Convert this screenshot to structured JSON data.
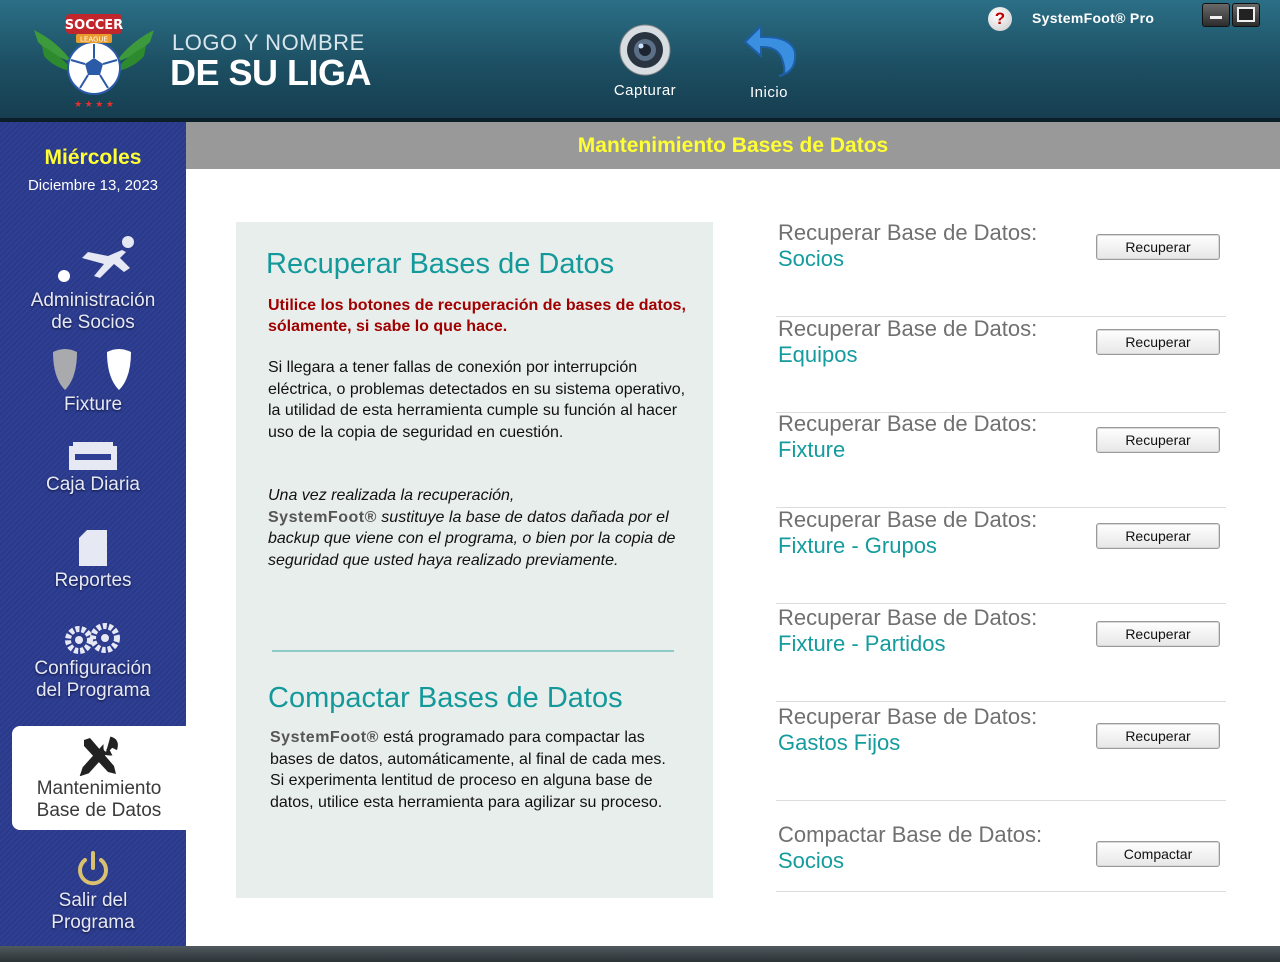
{
  "header": {
    "logo_text_line1": "LOGO Y NOMBRE",
    "logo_text_line2": "DE SU LIGA",
    "logo_badge_top": "SOCCER",
    "logo_badge_sub": "LEAGUE",
    "capture_label": "Capturar",
    "home_label": "Inicio",
    "help_symbol": "?",
    "brand": "SystemFoot® Pro"
  },
  "sidebar": {
    "day": "Miércoles",
    "date": "Diciembre 13, 2023",
    "items": [
      {
        "line1": "Administración",
        "line2": "de Socios",
        "icon": "soccer-player-icon"
      },
      {
        "line1": "Fixture",
        "line2": "",
        "icon": "shields-icon"
      },
      {
        "line1": "Caja Diaria",
        "line2": "",
        "icon": "cash-drawer-icon"
      },
      {
        "line1": "Reportes",
        "line2": "",
        "icon": "document-icon"
      },
      {
        "line1": "Configuración",
        "line2": "del Programa",
        "icon": "gears-icon"
      },
      {
        "line1": "Mantenimiento",
        "line2": "Base de Datos",
        "icon": "tools-icon"
      },
      {
        "line1": "Salir del",
        "line2": "Programa",
        "icon": "power-icon"
      }
    ]
  },
  "title": "Mantenimiento Bases de Datos",
  "panel": {
    "recover_heading": "Recuperar Bases de Datos",
    "warning": "Utilice los botones de recuperación de bases de datos, sólamente, si sabe lo que hace.",
    "p1": "Si llegara a tener fallas de conexión por interrupción eléctrica, o problemas detectados en su sistema operativo, la utilidad de esta herramienta cumple su función al hacer uso de la copia de seguridad en cuestión.",
    "p2_intro": "Una vez realizada la recuperación,",
    "p2_brand": "SystemFoot®",
    "p2_rest": " sustituye la base de datos dañada por el backup que viene con el programa, o bien por la copia de seguridad que usted haya realizado previamente.",
    "compact_heading": "Compactar Bases de Datos",
    "p3_brand": "SystemFoot®",
    "p3_rest": " está programado para compactar las bases de datos, automáticamente, al final de cada mes.",
    "p4": "Si experimenta lentitud de proceso en alguna base de datos, utilice esta herramienta para agilizar su proceso."
  },
  "rows": [
    {
      "label": "Recuperar Base de Datos:",
      "value": "Socios",
      "button": "Recuperar"
    },
    {
      "label": "Recuperar Base de Datos:",
      "value": "Equipos",
      "button": "Recuperar"
    },
    {
      "label": "Recuperar Base de Datos:",
      "value": "Fixture",
      "button": "Recuperar"
    },
    {
      "label": "Recuperar Base de Datos:",
      "value": "Fixture - Grupos",
      "button": "Recuperar"
    },
    {
      "label": "Recuperar Base de Datos:",
      "value": "Fixture - Partidos",
      "button": "Recuperar"
    },
    {
      "label": "Recuperar Base de Datos:",
      "value": "Gastos Fijos",
      "button": "Recuperar"
    },
    {
      "label": "Compactar Base de Datos:",
      "value": "Socios",
      "button": "Compactar"
    }
  ]
}
